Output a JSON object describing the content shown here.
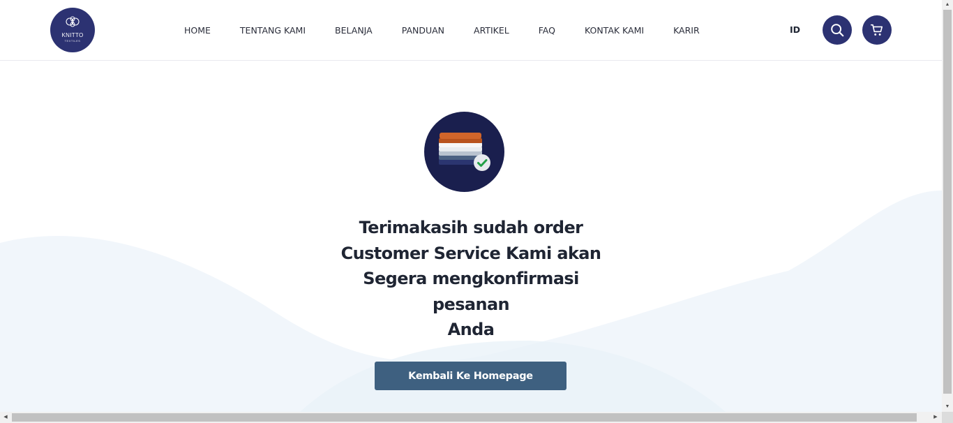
{
  "brand": {
    "name": "KNITTO",
    "tagline": "TEXTILES",
    "color": "#2c3272"
  },
  "nav": {
    "items": [
      {
        "label": "HOME"
      },
      {
        "label": "TENTANG KAMI"
      },
      {
        "label": "BELANJA"
      },
      {
        "label": "PANDUAN"
      },
      {
        "label": "ARTIKEL"
      },
      {
        "label": "FAQ"
      },
      {
        "label": "KONTAK KAMI"
      },
      {
        "label": "KARIR"
      }
    ],
    "language": "ID",
    "search_icon": "search-icon",
    "cart_icon": "cart-icon"
  },
  "main": {
    "message_lines": [
      "Terimakasih sudah order",
      "Customer Service Kami akan",
      "Segera mengkonfirmasi pesanan",
      "Anda"
    ],
    "button_label": "Kembali Ke Homepage",
    "button_color": "#3e6080",
    "badge_icon": "fabric-stack-check-icon"
  },
  "colors": {
    "primary": "#2c3272",
    "wave": "#eef4fa",
    "check": "#22a046"
  }
}
